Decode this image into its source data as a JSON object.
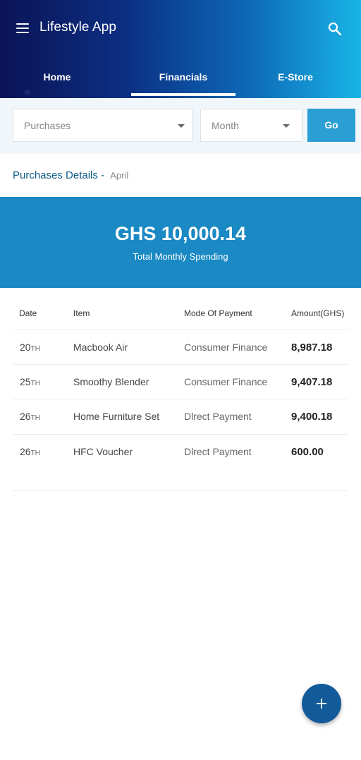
{
  "app": {
    "title": "Lifestyle App"
  },
  "tabs": [
    {
      "label": "Home",
      "active": false
    },
    {
      "label": "Financials",
      "active": true
    },
    {
      "label": "E-Store",
      "active": false
    }
  ],
  "filters": {
    "category": "Purchases",
    "month": "Month",
    "go_label": "Go"
  },
  "section": {
    "label": "Purchases Details -",
    "month": "April"
  },
  "summary": {
    "amount": "GHS 10,000.14",
    "caption": "Total Monthly Spending"
  },
  "table": {
    "headers": {
      "date": "Date",
      "item": "Item",
      "mode": "Mode Of Payment",
      "amount": "Amount(GHS)"
    },
    "rows": [
      {
        "day": "20",
        "suffix": "TH",
        "item": "Macbook Air",
        "mode": "Consumer Finance",
        "amount": "8,987.18"
      },
      {
        "day": "25",
        "suffix": "TH",
        "item": "Smoothy Blender",
        "mode": "Consumer Finance",
        "amount": "9,407.18"
      },
      {
        "day": "26",
        "suffix": "TH",
        "item": "Home Furniture Set",
        "mode": "Dlrect Payment",
        "amount": "9,400.18"
      },
      {
        "day": "26",
        "suffix": "TH",
        "item": "HFC Voucher",
        "mode": "Dlrect Payment",
        "amount": "600.00"
      }
    ]
  },
  "icons": {
    "menu": "menu-icon",
    "search": "search-icon",
    "add": "plus-icon"
  },
  "colors": {
    "summary_bg": "#1a89c4",
    "go_button": "#2b9fd3",
    "fab": "#135a9a",
    "accent_text": "#0d5a87"
  }
}
